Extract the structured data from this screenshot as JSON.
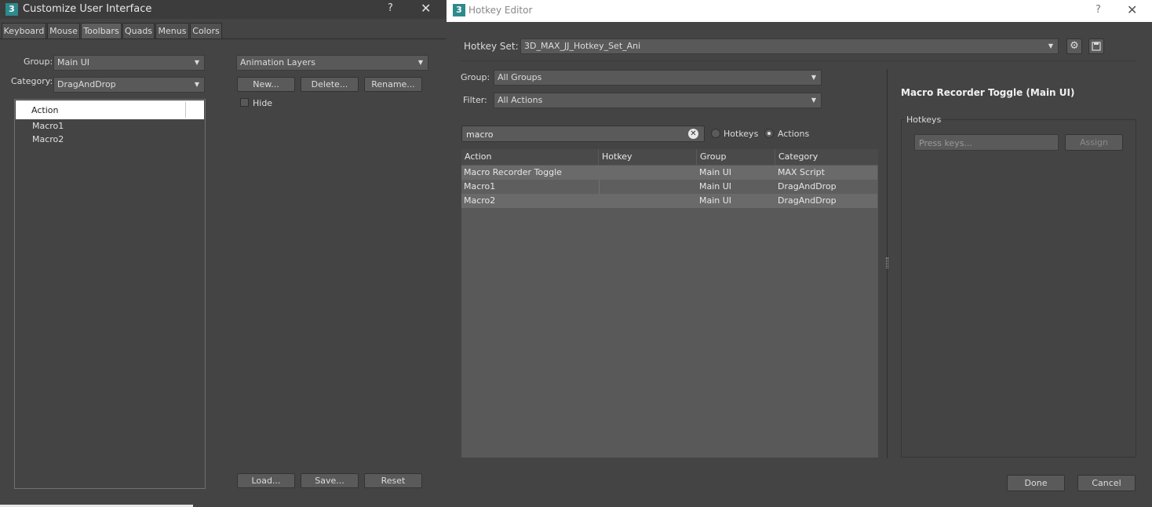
{
  "left_window": {
    "title": "Customize User Interface",
    "help": "?",
    "close": "✕",
    "app_icon": "3",
    "tabs": [
      "Keyboard",
      "Mouse",
      "Toolbars",
      "Quads",
      "Menus",
      "Colors"
    ],
    "active_tab": "Toolbars",
    "group_label": "Group:",
    "group_value": "Main UI",
    "category_label": "Category:",
    "category_value": "DragAndDrop",
    "list_header": "Action",
    "actions": [
      "Macro1",
      "Macro2"
    ],
    "toolbar_value": "Animation Layers",
    "new_btn": "New...",
    "delete_btn": "Delete...",
    "rename_btn": "Rename...",
    "hide_label": "Hide",
    "load_btn": "Load...",
    "save_btn": "Save...",
    "reset_btn": "Reset"
  },
  "hotkey_editor": {
    "title": "Hotkey Editor",
    "help": "?",
    "close": "✕",
    "app_icon": "3",
    "hotkey_set_label": "Hotkey Set:",
    "hotkey_set_value": "3D_MAX_JJ_Hotkey_Set_Ani",
    "group_label": "Group:",
    "group_value": "All Groups",
    "filter_label": "Filter:",
    "filter_value": "All Actions",
    "search_value": "macro",
    "radio_hotkeys": "Hotkeys",
    "radio_actions": "Actions",
    "selected_radio": "Actions",
    "columns": [
      "Action",
      "Hotkey",
      "Group",
      "Category"
    ],
    "rows": [
      {
        "action": "Macro Recorder Toggle",
        "hotkey": "",
        "group": "Main UI",
        "category": "MAX Script"
      },
      {
        "action": "Macro1",
        "hotkey": "",
        "group": "Main UI",
        "category": "DragAndDrop"
      },
      {
        "action": "Macro2",
        "hotkey": "",
        "group": "Main UI",
        "category": "DragAndDrop"
      }
    ],
    "detail_title": "Macro Recorder Toggle (Main UI)",
    "hotkeys_group_label": "Hotkeys",
    "press_keys_placeholder": "Press keys...",
    "assign_btn": "Assign",
    "done_btn": "Done",
    "cancel_btn": "Cancel"
  },
  "icons": {
    "settings": "gear-icon",
    "save": "floppy-icon",
    "clear_search": "clear-icon"
  }
}
